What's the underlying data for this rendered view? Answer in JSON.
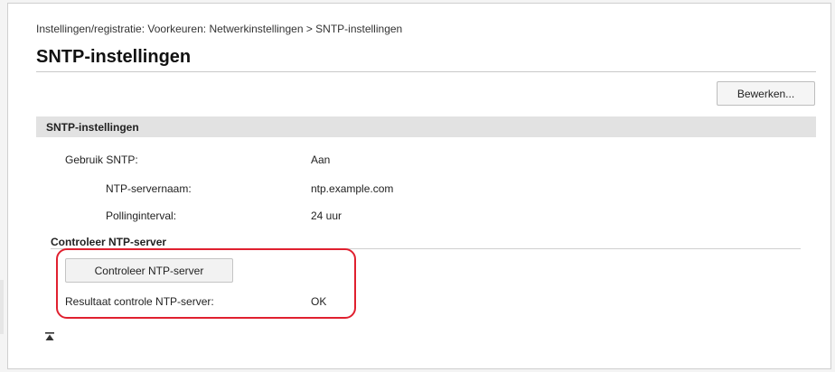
{
  "breadcrumb": "Instellingen/registratie: Voorkeuren: Netwerkinstellingen > SNTP-instellingen",
  "page_title": "SNTP-instellingen",
  "edit_button": "Bewerken...",
  "section": {
    "title": "SNTP-instellingen",
    "rows": [
      {
        "label": "Gebruik SNTP:",
        "value": "Aan"
      },
      {
        "label": "NTP-servernaam:",
        "value": "ntp.example.com"
      },
      {
        "label": "Pollinginterval:",
        "value": "24 uur"
      }
    ]
  },
  "check": {
    "title": "Controleer NTP-server",
    "button_label": "Controleer NTP-server",
    "result_label": "Resultaat controle NTP-server:",
    "result_value": "OK"
  },
  "top_icon": "to-top-icon",
  "colors": {
    "highlight": "#e0202f",
    "section_header": "#e2e2e2"
  }
}
